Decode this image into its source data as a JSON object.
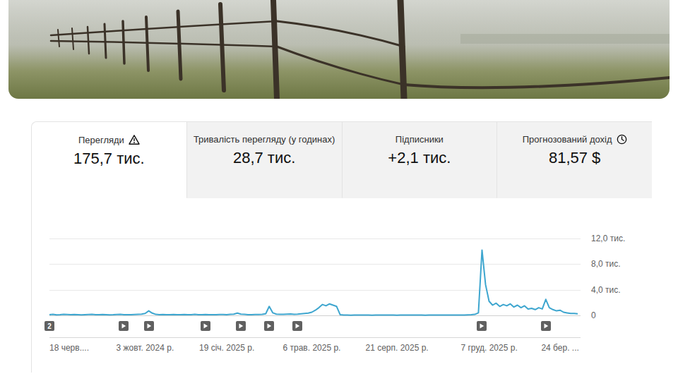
{
  "tabs": [
    {
      "label": "Перегляди",
      "value": "175,7 тис.",
      "selected": true,
      "kind": "warning"
    },
    {
      "label": "Тривалість перегляду (у годинах)",
      "value": "28,7 тис.",
      "selected": false,
      "kind": "plain"
    },
    {
      "label": "Підписники",
      "value": "+2,1 тис.",
      "selected": false,
      "kind": "plain"
    },
    {
      "label": "Прогнозований дохід",
      "value": "81,57 $",
      "selected": false,
      "kind": "estimated"
    }
  ],
  "chart": {
    "y_ticks": [
      {
        "label": "12,0 тис.",
        "value": 12000
      },
      {
        "label": "8,0 тис.",
        "value": 8000
      },
      {
        "label": "4,0 тис.",
        "value": 4000
      },
      {
        "label": "0",
        "value": 0
      }
    ],
    "x_ticks": [
      {
        "label": "18 черв....",
        "index": 0
      },
      {
        "label": "3 жовт. 2024 р.",
        "index": 27
      },
      {
        "label": "19 січ. 2025 р.",
        "index": 50
      },
      {
        "label": "6 трав. 2025 р.",
        "index": 74
      },
      {
        "label": "21 серп. 2025 р.",
        "index": 98
      },
      {
        "label": "7 груд. 2025 р.",
        "index": 124
      },
      {
        "label": "24 бер. ...",
        "index": 144
      }
    ],
    "markers": [
      {
        "kind": "group",
        "label": "2",
        "index": 0
      },
      {
        "kind": "video",
        "index": 21
      },
      {
        "kind": "video",
        "index": 28
      },
      {
        "kind": "video",
        "index": 44
      },
      {
        "kind": "video",
        "index": 54
      },
      {
        "kind": "video",
        "index": 62
      },
      {
        "kind": "video",
        "index": 70
      },
      {
        "kind": "video",
        "index": 122
      },
      {
        "kind": "video",
        "index": 140
      }
    ],
    "series": [
      {
        "name": "Перегляди",
        "color": "#3ea6cf",
        "values": [
          120,
          150,
          90,
          110,
          160,
          130,
          100,
          140,
          120,
          90,
          110,
          130,
          150,
          100,
          120,
          140,
          110,
          90,
          100,
          130,
          150,
          120,
          110,
          100,
          140,
          160,
          200,
          300,
          700,
          350,
          150,
          120,
          130,
          110,
          100,
          140,
          120,
          110,
          130,
          100,
          120,
          150,
          110,
          100,
          130,
          120,
          110,
          100,
          140,
          130,
          120,
          150,
          200,
          350,
          200,
          150,
          120,
          110,
          140,
          130,
          160,
          250,
          1400,
          400,
          200,
          180,
          160,
          200,
          220,
          180,
          200,
          250,
          300,
          350,
          500,
          800,
          1200,
          1700,
          1500,
          1800,
          1600,
          1400,
          100,
          40,
          50,
          30,
          40,
          60,
          50,
          40,
          50,
          30,
          40,
          50,
          60,
          40,
          50,
          40,
          30,
          50,
          40,
          50,
          60,
          40,
          50,
          40,
          30,
          50,
          60,
          40,
          50,
          40,
          50,
          60,
          50,
          40,
          50,
          60,
          80,
          100,
          150,
          400,
          10200,
          4800,
          2200,
          1600,
          1900,
          1400,
          1700,
          1500,
          1800,
          1300,
          1600,
          1200,
          1500,
          1000,
          1100,
          900,
          1200,
          1000,
          2500,
          1200,
          900,
          700,
          800,
          500,
          400,
          300,
          300,
          250
        ]
      }
    ]
  }
}
